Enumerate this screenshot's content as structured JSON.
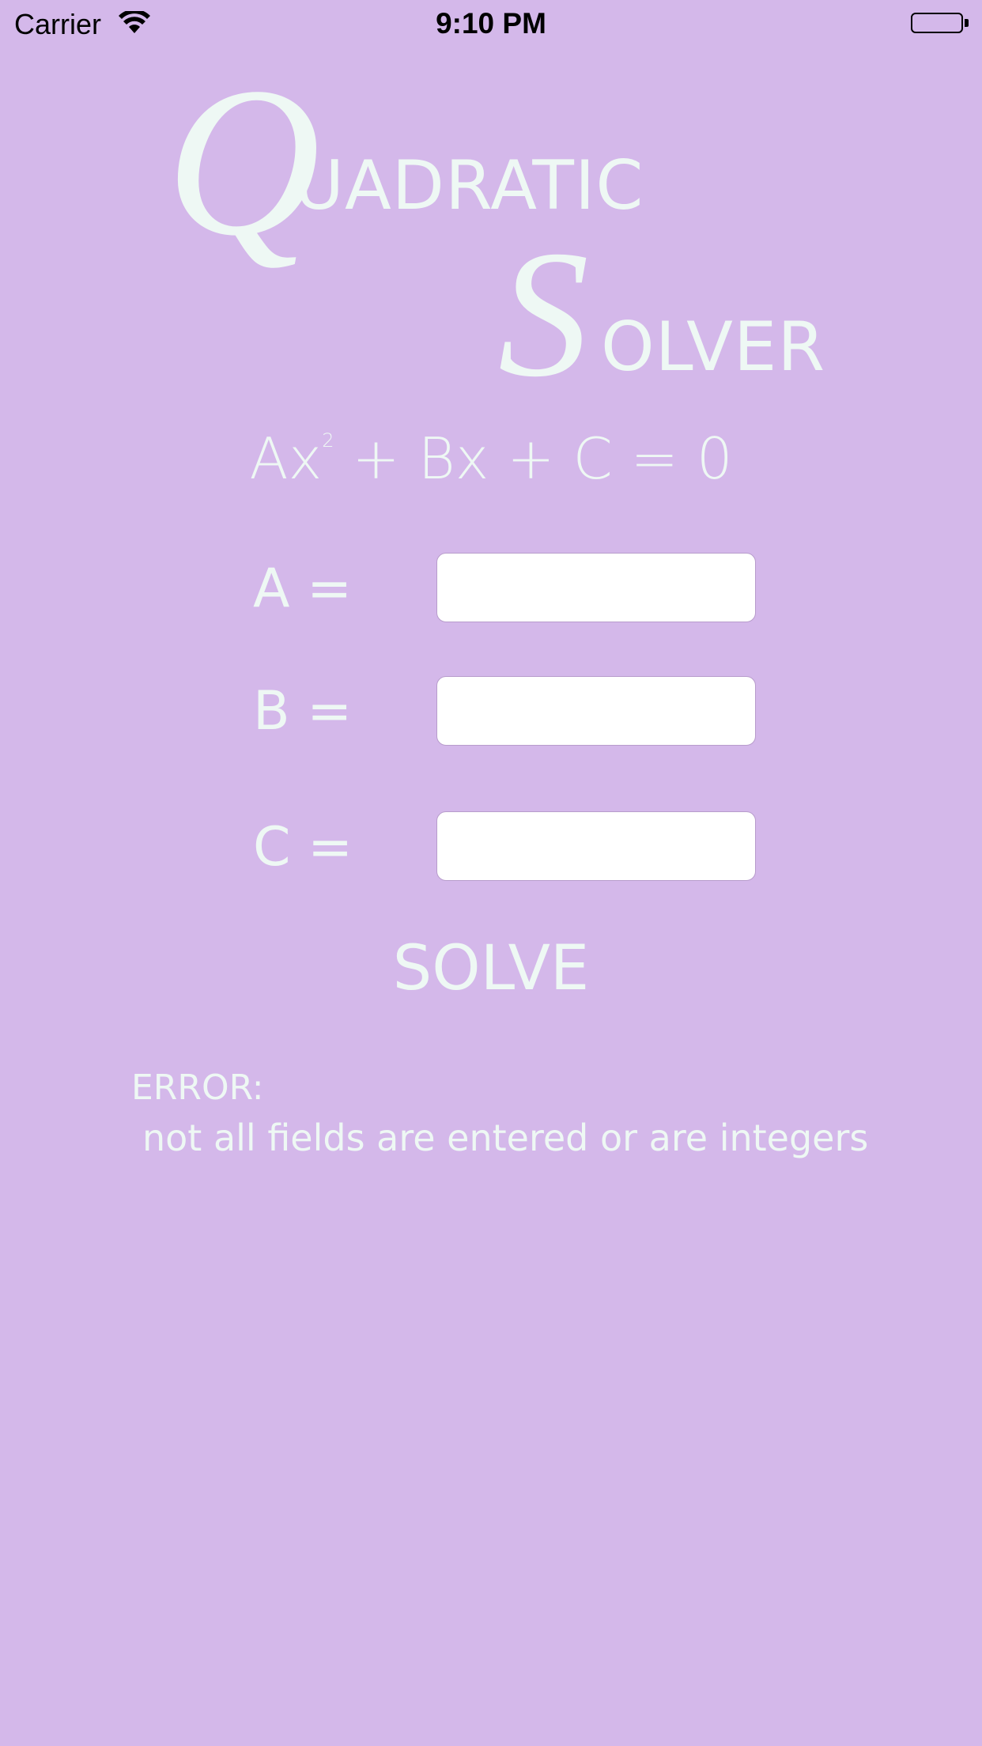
{
  "status_bar": {
    "carrier": "Carrier",
    "time": "9:10 PM",
    "wifi_icon": "wifi-icon",
    "battery_icon": "battery-full-icon"
  },
  "title": {
    "line1_cap": "Q",
    "line1_rest": "UADRATIC",
    "line2_cap": "S",
    "line2_rest": "OLVER"
  },
  "equation": {
    "left": "Ax",
    "exponent": "2",
    "right": " + Bx + C = 0"
  },
  "form": {
    "a_label": "A =",
    "b_label": "B =",
    "c_label": "C =",
    "a_value": "",
    "b_value": "",
    "c_value": ""
  },
  "solve_button": "SOLVE",
  "error": {
    "title": "ERROR:",
    "message": "not all fields are entered or are integers"
  },
  "colors": {
    "background": "#d4b8ea",
    "text": "#eef8f4",
    "field_background": "#ffffff"
  }
}
